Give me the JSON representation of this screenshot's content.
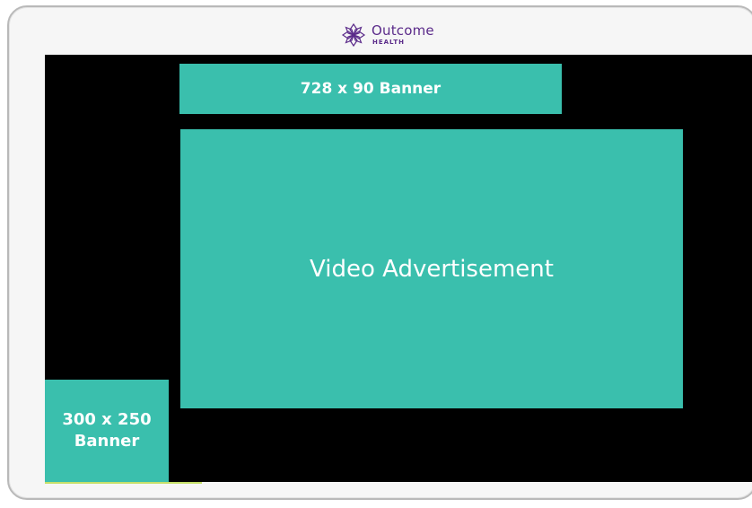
{
  "brand": {
    "name": "Outcome",
    "sub": "HEALTH",
    "color": "#5b2b8a"
  },
  "ads": {
    "leaderboard_label": "728 x 90 Banner",
    "video_label": "Video Advertisement",
    "rect_line1": "300 x 250",
    "rect_line2": "Banner",
    "fill_color": "#3abfad"
  },
  "screen": {
    "background": "#000000"
  }
}
